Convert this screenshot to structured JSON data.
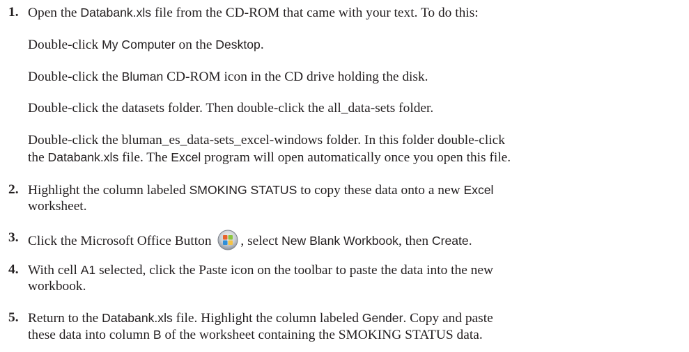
{
  "steps": [
    {
      "number": "1.",
      "lines": [
        [
          "Open the ",
          "Databank.xls",
          " file from the CD-ROM that came with your text. To do this:"
        ]
      ]
    },
    {
      "substeps": [
        [
          "Double-click ",
          "My Computer",
          " on the ",
          "Desktop",
          "."
        ],
        [
          "Double-click the ",
          "Bluman",
          " CD-ROM icon in the CD drive holding the disk."
        ],
        [
          "Double-click the datasets folder. Then double-click the all_data-sets folder."
        ],
        [
          "Double-click the bluman_es_data-sets_excel-windows folder. In this folder double-click"
        ],
        [
          "the ",
          "Databank.xls",
          " file. The ",
          "Excel",
          " program will open automatically once you open this file."
        ]
      ]
    },
    {
      "number": "2.",
      "lines": [
        [
          "Highlight the column labeled ",
          "SMOKING STATUS",
          " to copy these data onto a new ",
          "Excel"
        ],
        [
          "worksheet."
        ]
      ]
    },
    {
      "number": "3.",
      "lines": [
        [
          "Click the Microsoft Office Button ",
          "",
          ", select ",
          "New Blank Workbook",
          ", then ",
          "Create",
          "."
        ]
      ]
    },
    {
      "number": "4.",
      "lines": [
        [
          "With cell ",
          "A1",
          " selected, click the Paste icon on the toolbar to paste the data into the new"
        ],
        [
          "workbook."
        ]
      ]
    },
    {
      "number": "5.",
      "lines": [
        [
          "Return to the ",
          "Databank.xls",
          " file. Highlight the column labeled ",
          "Gender",
          ". Copy and paste"
        ],
        [
          "these data into column ",
          "B",
          " of the worksheet containing the SMOKING STATUS data."
        ]
      ]
    }
  ],
  "icons": {
    "office_button": "microsoft-office-button-icon"
  }
}
